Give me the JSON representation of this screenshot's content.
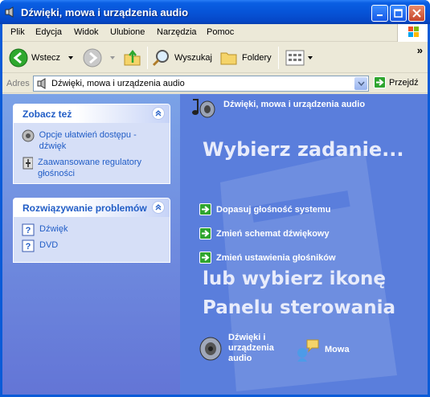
{
  "window": {
    "title": "Dźwięki, mowa i urządzenia audio"
  },
  "menu": [
    "Plik",
    "Edycja",
    "Widok",
    "Ulubione",
    "Narzędzia",
    "Pomoc"
  ],
  "toolbar": {
    "back": "Wstecz",
    "search": "Wyszukaj",
    "folders": "Foldery",
    "chevron": "»"
  },
  "address": {
    "label": "Adres",
    "value": "Dźwięki, mowa i urządzenia audio",
    "go": "Przejdź"
  },
  "see_also": {
    "title": "Zobacz też",
    "links": [
      "Opcje ułatwień dostępu - dźwięk",
      "Zaawansowane regulatory głośności"
    ]
  },
  "troubleshoot": {
    "title": "Rozwiązywanie problemów",
    "links": [
      "Dźwięk",
      "DVD"
    ]
  },
  "main": {
    "title": "Dźwięki, mowa i urządzenia audio",
    "task_heading": "Wybierz zadanie...",
    "tasks": [
      "Dopasuj głośność systemu",
      "Zmień schemat dźwiękowy",
      "Zmień ustawienia głośników"
    ],
    "icon_heading_1": "lub wybierz ikonę",
    "icon_heading_2": "Panelu sterowania",
    "icons": [
      "Dźwięki i urządzenia audio",
      "Mowa"
    ]
  },
  "colors": {
    "titlebar": "#0654d8",
    "pane": "#5a7edc",
    "link": "#215dc6"
  }
}
